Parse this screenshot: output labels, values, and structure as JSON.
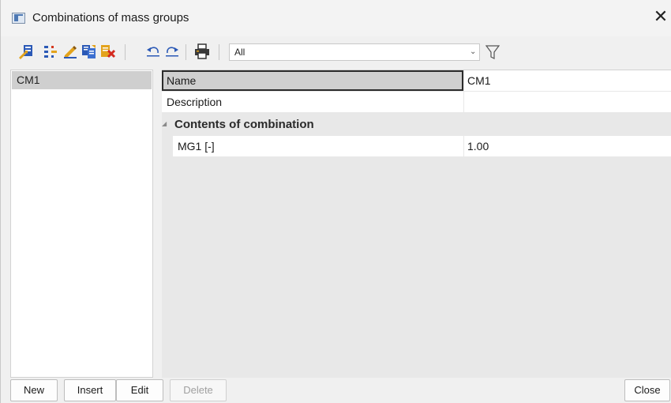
{
  "window": {
    "title": "Combinations of mass groups",
    "close_glyph": "✕"
  },
  "toolbar": {
    "icons": [
      "new-record-icon",
      "settings-tree-icon",
      "edit-pencil-icon",
      "copy-icon",
      "delete-icon",
      "undo-icon",
      "redo-icon",
      "print-icon"
    ],
    "filter_value": "All",
    "filter_arrow": "⌄",
    "filter_icon": "funnel-icon"
  },
  "list": {
    "items": [
      "CM1"
    ],
    "selected": "CM1"
  },
  "properties": {
    "name_label": "Name",
    "name_value": "CM1",
    "description_label": "Description",
    "description_value": "",
    "section_title": "Contents of combination",
    "section_glyph": "◢",
    "mg_label": "MG1 [-]",
    "mg_value": "1.00"
  },
  "buttons": {
    "new": "New",
    "insert": "Insert",
    "edit": "Edit",
    "delete": "Delete",
    "close": "Close"
  },
  "colors": {
    "selection": "#cfcfcf",
    "grid_background": "#e8e8e8",
    "window_background": "#f0f0f0"
  }
}
